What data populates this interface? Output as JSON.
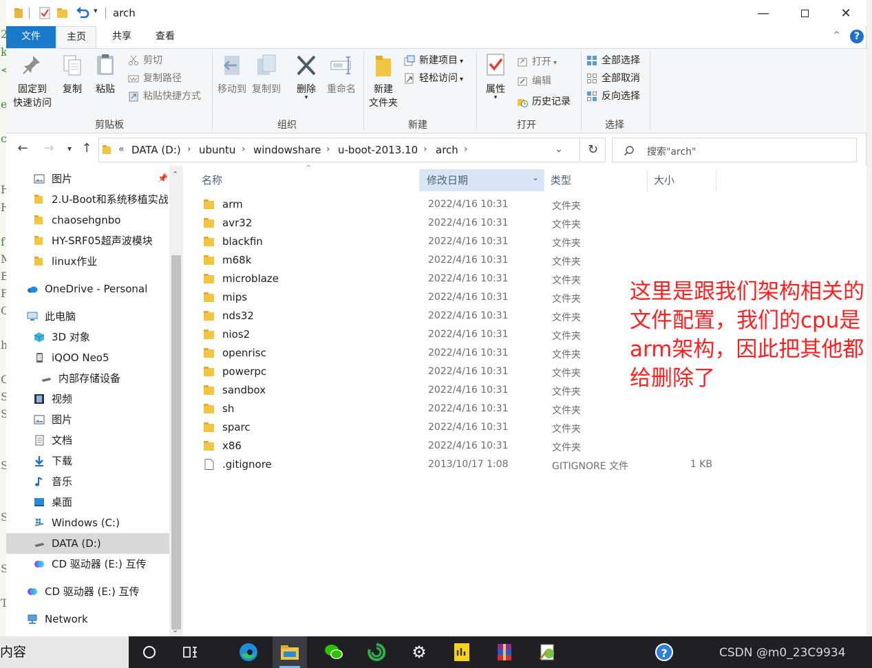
{
  "window": {
    "title": "arch"
  },
  "ribbon_tabs": [
    {
      "label": "文件"
    },
    {
      "label": "主页"
    },
    {
      "label": "共享"
    },
    {
      "label": "查看"
    }
  ],
  "ribbon": {
    "clipboard": {
      "group_label": "剪贴板",
      "pin_label_1": "固定到",
      "pin_label_2": "快速访问",
      "copy": "复制",
      "paste": "粘贴",
      "cut": "剪切",
      "copy_path": "复制路径",
      "paste_shortcut": "粘贴快捷方式"
    },
    "organize": {
      "group_label": "组织",
      "move_to": "移动到",
      "copy_to": "复制到",
      "delete": "删除",
      "rename": "重命名"
    },
    "new": {
      "group_label": "新建",
      "new_folder_1": "新建",
      "new_folder_2": "文件夹",
      "new_item": "新建项目",
      "easy_access": "轻松访问"
    },
    "open": {
      "group_label": "打开",
      "properties": "属性",
      "open": "打开",
      "edit": "编辑",
      "history": "历史记录"
    },
    "select": {
      "group_label": "选择",
      "select_all": "全部选择",
      "select_none": "全部取消",
      "invert": "反向选择"
    }
  },
  "address": {
    "crumbs": [
      "DATA (D:)",
      "ubuntu",
      "windowshare",
      "u-boot-2013.10",
      "arch"
    ],
    "overflow": "«",
    "search_placeholder": "搜索\"arch\""
  },
  "nav_pane": {
    "items": [
      {
        "label": "图片",
        "icon": "pictures-icon"
      },
      {
        "label": "2.U-Boot和系统移植实战",
        "icon": "folder-icon"
      },
      {
        "label": "chaosehgnbo",
        "icon": "folder-icon"
      },
      {
        "label": "HY-SRF05超声波模块",
        "icon": "folder-icon"
      },
      {
        "label": "linux作业",
        "icon": "folder-icon"
      },
      {
        "label": "OneDrive - Personal",
        "icon": "onedrive-icon"
      },
      {
        "label": "此电脑",
        "icon": "computer-icon"
      },
      {
        "label": "3D 对象",
        "icon": "3d-objects-icon"
      },
      {
        "label": "iQOO Neo5",
        "icon": "phone-icon"
      },
      {
        "label": "内部存储设备",
        "icon": "drive-icon"
      },
      {
        "label": "视频",
        "icon": "videos-icon"
      },
      {
        "label": "图片",
        "icon": "pictures-icon"
      },
      {
        "label": "文档",
        "icon": "documents-icon"
      },
      {
        "label": "下载",
        "icon": "downloads-icon"
      },
      {
        "label": "音乐",
        "icon": "music-icon"
      },
      {
        "label": "桌面",
        "icon": "desktop-icon"
      },
      {
        "label": "Windows (C:)",
        "icon": "windows-drive-icon"
      },
      {
        "label": "DATA (D:)",
        "icon": "drive-icon"
      },
      {
        "label": "CD 驱动器 (E:) 互传",
        "icon": "cd-drive-icon"
      },
      {
        "label": "CD 驱动器 (E:) 互传",
        "icon": "cd-drive-icon"
      },
      {
        "label": "Network",
        "icon": "network-icon"
      }
    ],
    "selected_label": "DATA (D:)"
  },
  "columns": {
    "name": "名称",
    "date": "修改日期",
    "type": "类型",
    "size": "大小"
  },
  "files": [
    {
      "name": "arm",
      "date": "2022/4/16 10:31",
      "type": "文件夹",
      "size": ""
    },
    {
      "name": "avr32",
      "date": "2022/4/16 10:31",
      "type": "文件夹",
      "size": ""
    },
    {
      "name": "blackfin",
      "date": "2022/4/16 10:31",
      "type": "文件夹",
      "size": ""
    },
    {
      "name": "m68k",
      "date": "2022/4/16 10:31",
      "type": "文件夹",
      "size": ""
    },
    {
      "name": "microblaze",
      "date": "2022/4/16 10:31",
      "type": "文件夹",
      "size": ""
    },
    {
      "name": "mips",
      "date": "2022/4/16 10:31",
      "type": "文件夹",
      "size": ""
    },
    {
      "name": "nds32",
      "date": "2022/4/16 10:31",
      "type": "文件夹",
      "size": ""
    },
    {
      "name": "nios2",
      "date": "2022/4/16 10:31",
      "type": "文件夹",
      "size": ""
    },
    {
      "name": "openrisc",
      "date": "2022/4/16 10:31",
      "type": "文件夹",
      "size": ""
    },
    {
      "name": "powerpc",
      "date": "2022/4/16 10:31",
      "type": "文件夹",
      "size": ""
    },
    {
      "name": "sandbox",
      "date": "2022/4/16 10:31",
      "type": "文件夹",
      "size": ""
    },
    {
      "name": "sh",
      "date": "2022/4/16 10:31",
      "type": "文件夹",
      "size": ""
    },
    {
      "name": "sparc",
      "date": "2022/4/16 10:31",
      "type": "文件夹",
      "size": ""
    },
    {
      "name": "x86",
      "date": "2022/4/16 10:31",
      "type": "文件夹",
      "size": ""
    },
    {
      "name": ".gitignore",
      "date": "2013/10/17 1:08",
      "type": "GITIGNORE 文件",
      "size": "1 KB"
    }
  ],
  "annotation": {
    "text": "这里是跟我们架构相关的文件配置，我们的cpu是arm架构，因此把其他都给删除了",
    "color": "#ff1f1f"
  },
  "taskbar": {
    "left_text": "内容",
    "watermark": "CSDN @m0_23C9934"
  },
  "colors": {
    "file_tab": "#1979ca",
    "folder": "#f4c542",
    "sorted_header": "#d9e6f5",
    "selection": "#d9d9d9"
  }
}
